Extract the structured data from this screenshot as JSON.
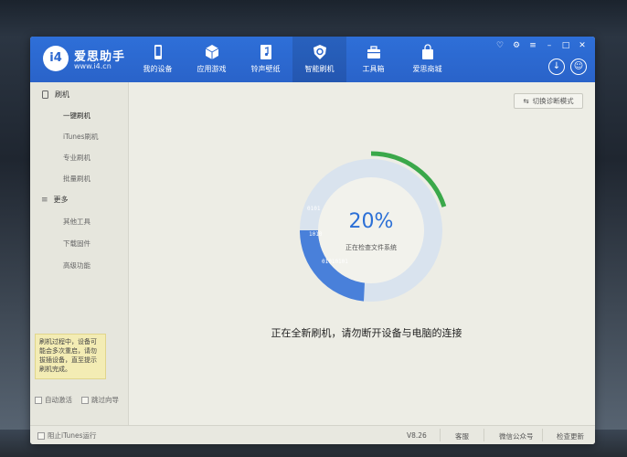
{
  "app": {
    "logo_text": "i4",
    "name": "爱思助手",
    "url": "www.i4.cn"
  },
  "nav": [
    {
      "label": "我的设备",
      "icon": "phone-icon"
    },
    {
      "label": "应用游戏",
      "icon": "cube-icon"
    },
    {
      "label": "铃声壁纸",
      "icon": "music-file-icon"
    },
    {
      "label": "智能刷机",
      "icon": "shield-gear-icon",
      "active": true
    },
    {
      "label": "工具箱",
      "icon": "toolbox-icon"
    },
    {
      "label": "爱思商城",
      "icon": "shopping-bag-icon"
    }
  ],
  "sidebar": {
    "flash_section": "刷机",
    "flash_items": [
      "一键刷机",
      "iTunes刷机",
      "专业刷机",
      "批量刷机"
    ],
    "more_section": "更多",
    "more_items": [
      "其他工具",
      "下载固件",
      "高级功能"
    ],
    "tip": "刷机过程中，设备可能会多次重启，请勿拔插设备，直至提示刷机完成。",
    "auto_activate": "自动激活",
    "skip_guide": "跳过向导"
  },
  "main": {
    "diag_button": "切换诊断模式",
    "progress_percent": "20%",
    "progress_value": 0.2,
    "progress_status": "正在检查文件系统",
    "message": "正在全新刷机，请勿断开设备与电脑的连接"
  },
  "statusbar": {
    "block_itunes": "阻止iTunes运行",
    "version": "V8.26",
    "support": "客服",
    "wechat": "微信公众号",
    "update": "检查更新"
  },
  "colors": {
    "header_blue": "#2e6fd8",
    "progress_green": "#3aa84a",
    "ring_blue": "#2b6fd6"
  }
}
